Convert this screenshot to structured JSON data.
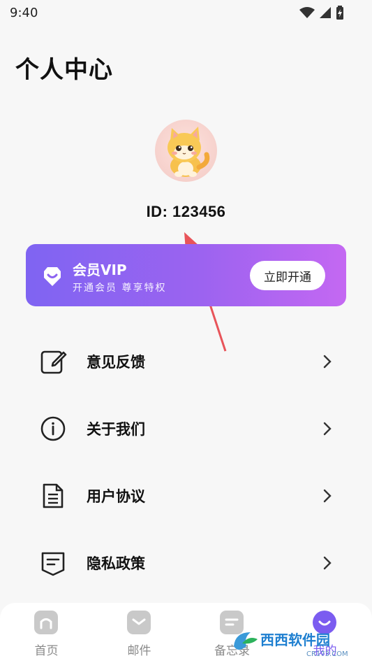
{
  "status_bar": {
    "time": "9:40",
    "icons": [
      "wifi-icon",
      "cellular-icon",
      "battery-charging-icon"
    ]
  },
  "header": {
    "title": "个人中心"
  },
  "profile": {
    "avatar": "cat-avatar",
    "id_text": "ID: 123456"
  },
  "vip_card": {
    "title": "会员VIP",
    "subtitle": "开通会员 尊享特权",
    "button_label": "立即开通",
    "icon": "vip-shield-icon",
    "gradient": [
      "#7f64f2",
      "#c468f2"
    ]
  },
  "menu": {
    "items": [
      {
        "label": "意见反馈",
        "icon": "feedback-edit-icon"
      },
      {
        "label": "关于我们",
        "icon": "info-icon"
      },
      {
        "label": "用户协议",
        "icon": "document-icon"
      },
      {
        "label": "隐私政策",
        "icon": "privacy-note-icon"
      }
    ]
  },
  "tab_bar": {
    "tabs": [
      {
        "label": "首页",
        "icon": "home-icon",
        "active": false
      },
      {
        "label": "邮件",
        "icon": "mail-icon",
        "active": false
      },
      {
        "label": "备忘录",
        "icon": "memo-icon",
        "active": false
      },
      {
        "label": "我的",
        "icon": "profile-smile-icon",
        "active": true
      }
    ],
    "active_color": "#7b5cf0"
  },
  "watermark": {
    "text": "西西软件园",
    "subtext": "CR173.COM"
  },
  "colors": {
    "accent": "#7b5cf0",
    "arrow": "#e8545a"
  }
}
